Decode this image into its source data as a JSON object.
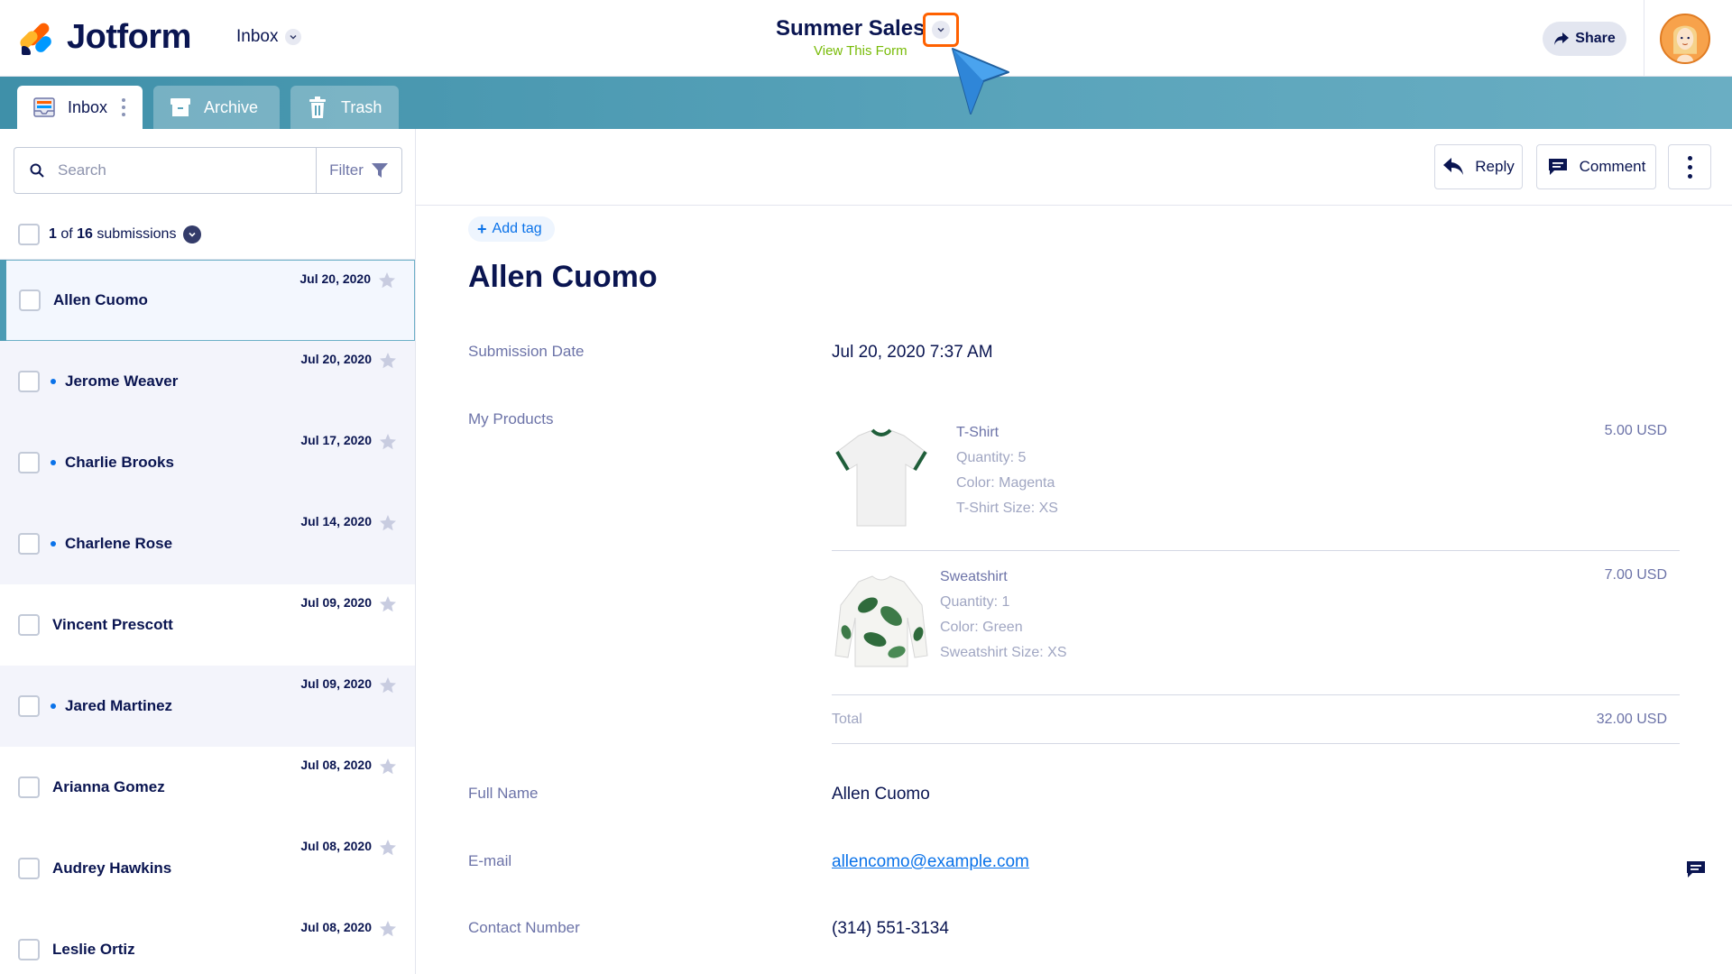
{
  "header": {
    "brand": "Jotform",
    "inbox_select": "Inbox",
    "form_title": "Summer Sales",
    "view_form": "View This Form",
    "share_label": "Share"
  },
  "tabs": [
    {
      "label": "Inbox",
      "icon": "inbox-icon",
      "active": true
    },
    {
      "label": "Archive",
      "icon": "archive-icon",
      "active": false
    },
    {
      "label": "Trash",
      "icon": "trash-icon",
      "active": false
    }
  ],
  "sidebar": {
    "search_placeholder": "Search",
    "filter_label": "Filter",
    "count": {
      "current": "1",
      "of": "of",
      "total": "16",
      "suffix": "submissions"
    },
    "submissions": [
      {
        "name": "Allen Cuomo",
        "date": "Jul 20, 2020",
        "unread": false,
        "selected": true
      },
      {
        "name": "Jerome Weaver",
        "date": "Jul 20, 2020",
        "unread": true,
        "selected": false
      },
      {
        "name": "Charlie Brooks",
        "date": "Jul 17, 2020",
        "unread": true,
        "selected": false
      },
      {
        "name": "Charlene Rose",
        "date": "Jul 14, 2020",
        "unread": true,
        "selected": false
      },
      {
        "name": "Vincent Prescott",
        "date": "Jul 09, 2020",
        "unread": false,
        "selected": false
      },
      {
        "name": "Jared Martinez",
        "date": "Jul 09, 2020",
        "unread": true,
        "selected": false
      },
      {
        "name": "Arianna Gomez",
        "date": "Jul 08, 2020",
        "unread": false,
        "selected": false
      },
      {
        "name": "Audrey Hawkins",
        "date": "Jul 08, 2020",
        "unread": false,
        "selected": false
      },
      {
        "name": "Leslie Ortiz",
        "date": "Jul 08, 2020",
        "unread": false,
        "selected": false
      }
    ]
  },
  "toolbar": {
    "reply_label": "Reply",
    "comment_label": "Comment"
  },
  "detail": {
    "add_tag": "Add tag",
    "name": "Allen Cuomo",
    "submission_date_label": "Submission Date",
    "submission_date": "Jul 20, 2020 7:37 AM",
    "products_label": "My Products",
    "products": [
      {
        "name": "T-Shirt",
        "quantity": "Quantity: 5",
        "color": "Color: Magenta",
        "size": "T-Shirt Size: XS",
        "price": "5.00 USD"
      },
      {
        "name": "Sweatshirt",
        "quantity": "Quantity: 1",
        "color": "Color: Green",
        "size": "Sweatshirt Size: XS",
        "price": "7.00 USD"
      }
    ],
    "total_label": "Total",
    "total_value": "32.00 USD",
    "full_name_label": "Full Name",
    "full_name": "Allen Cuomo",
    "email_label": "E-mail",
    "email": "allencomo@example.com",
    "contact_label": "Contact Number",
    "contact": "(314) 551-3134"
  },
  "colors": {
    "brand_navy": "#0a1551",
    "accent_orange": "#ff6100",
    "tabs_teal": "#4c9bb4",
    "link_blue": "#0a72e9",
    "view_form_green": "#78bb07"
  }
}
